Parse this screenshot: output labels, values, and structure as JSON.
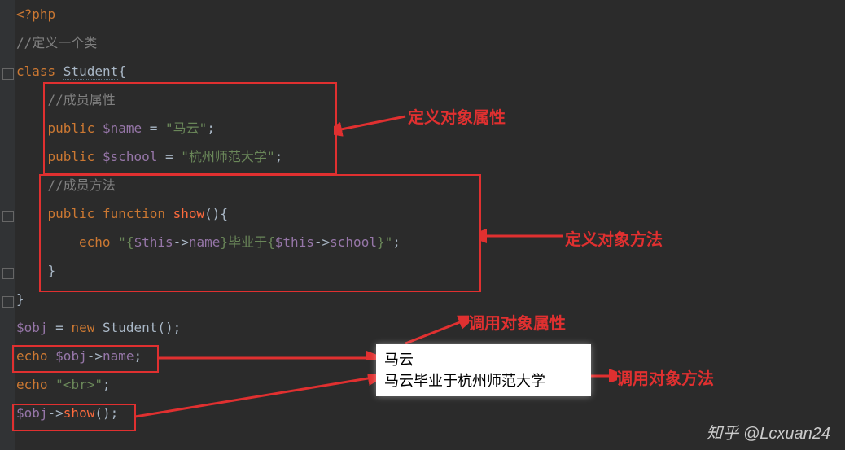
{
  "code": {
    "l1_open": "<?php",
    "l2_cmt": "//定义一个类",
    "l3_kw_class": "class ",
    "l3_name": "Student",
    "l3_brace": "{",
    "l4_cmt": "//成员属性",
    "l5_kw": "public ",
    "l5_var": "$name",
    "l5_eq": " = ",
    "l5_q": "\"",
    "l5_str": "马云",
    "l5_end": ";",
    "l6_kw": "public ",
    "l6_var": "$school",
    "l6_eq": " = ",
    "l6_q": "\"",
    "l6_str": "杭州师范大学",
    "l6_end": ";",
    "l7_cmt": "//成员方法",
    "l8_kw": "public function ",
    "l8_fn": "show",
    "l8_paren": "(){",
    "l9_kw": "echo ",
    "l9_q": "\"",
    "l9_p1": "{",
    "l9_v1": "$this",
    "l9_arrow": "->",
    "l9_f1": "name",
    "l9_p2": "}",
    "l9_txt": "毕业于",
    "l9_p3": "{",
    "l9_v2": "$this",
    "l9_f2": "school",
    "l9_p4": "}",
    "l9_end": ";",
    "l10_brace": "}",
    "l11_brace": "}",
    "l12_var": "$obj",
    "l12_eq": " = ",
    "l12_kw": "new ",
    "l12_cls": "Student",
    "l12_paren": "();",
    "l13_kw": "echo ",
    "l13_var": "$obj",
    "l13_arrow": "->",
    "l13_field": "name",
    "l13_end": ";",
    "l14_kw": "echo ",
    "l14_q": "\"",
    "l14_str": "<br>",
    "l14_end": ";",
    "l15_var": "$obj",
    "l15_arrow": "->",
    "l15_fn": "show",
    "l15_paren": "();"
  },
  "labels": {
    "defprop": "定义对象属性",
    "defmethod": "定义对象方法",
    "callprop": "调用对象属性",
    "callmethod": "调用对象方法"
  },
  "output": {
    "line1": "马云",
    "line2": "马云毕业于杭州师范大学"
  },
  "watermark": "知乎 @Lcxuan24"
}
